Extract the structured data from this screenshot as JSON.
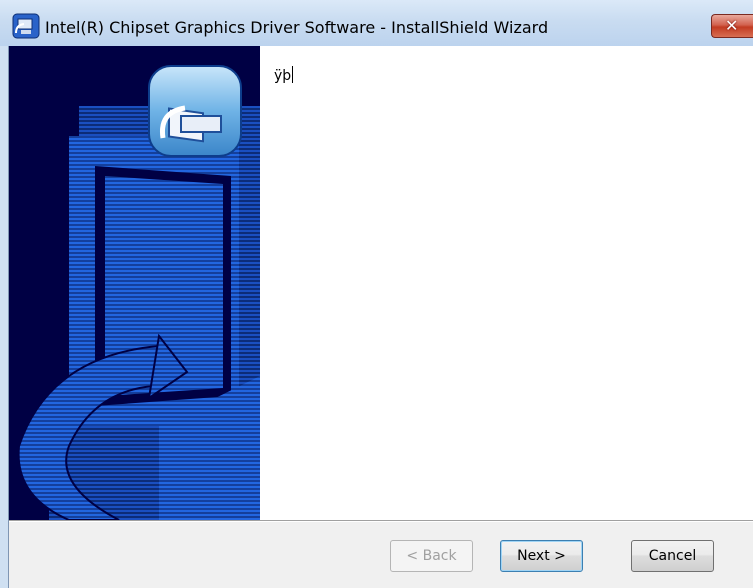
{
  "window": {
    "title": "Intel(R) Chipset Graphics Driver Software - InstallShield Wizard",
    "close_glyph": "✕"
  },
  "content": {
    "text": "ÿþ"
  },
  "buttons": {
    "back": "< Back",
    "next": "Next >",
    "cancel": "Cancel"
  },
  "colors": {
    "banner_background": "#000044",
    "banner_blue": "#1e5cd8",
    "close_red": "#c23b22"
  },
  "icons": {
    "app": "installshield-computer-icon",
    "banner": "installer-computer-icon"
  }
}
